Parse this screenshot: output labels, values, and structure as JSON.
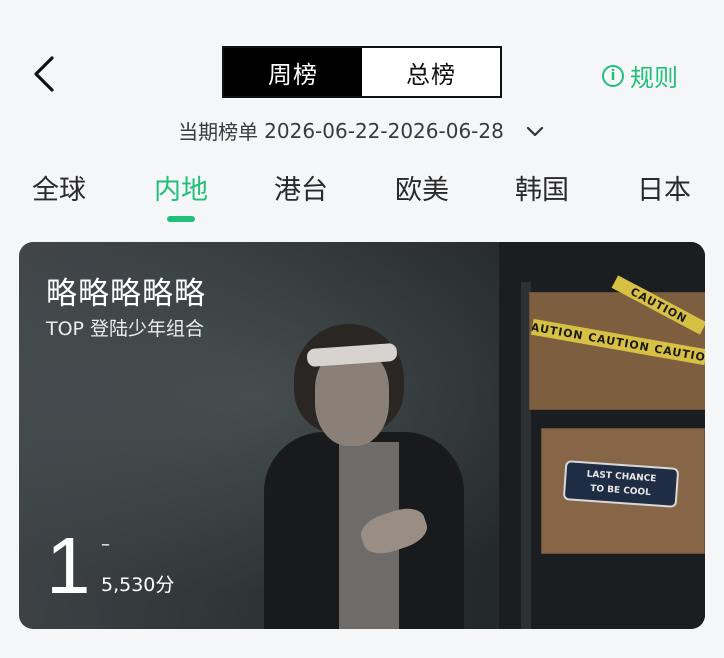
{
  "nav": {
    "back_icon": "chevron-left-icon"
  },
  "segment": {
    "weekly": "周榜",
    "overall": "总榜",
    "selected": "weekly"
  },
  "rules": {
    "icon": "info-icon",
    "icon_glyph": "i",
    "label": "规则"
  },
  "period": {
    "label": "当期榜单",
    "range": "2026-06-22-2026-06-28",
    "dropdown_icon": "chevron-down-icon"
  },
  "tabs": [
    {
      "label": "全球"
    },
    {
      "label": "内地"
    },
    {
      "label": "港台"
    },
    {
      "label": "欧美"
    },
    {
      "label": "韩国"
    },
    {
      "label": "日本"
    }
  ],
  "active_tab": "内地",
  "card": {
    "title": "略略略略略",
    "subtitle": "TOP 登陆少年组合",
    "rank": "1",
    "rank_change": "–",
    "score": "5,530分",
    "tape_text": "CAUTION  CAUTION  CAUTION",
    "tape_text_short": "CAUTION",
    "sign_line1": "LAST CHANCE",
    "sign_line2": "TO BE COOL"
  },
  "colors": {
    "accent": "#21c07a",
    "background": "#f5f6f8",
    "segment_active_bg": "#000000"
  }
}
